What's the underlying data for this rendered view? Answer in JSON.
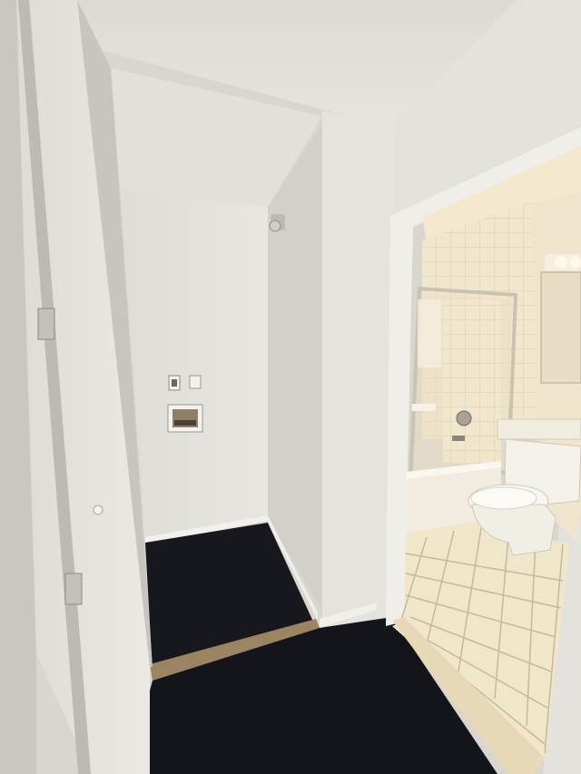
{
  "scene": {
    "subject": "hallway",
    "colors": {
      "ceiling": "#e4e2dc",
      "wall": "#e1dfd9",
      "wall_shadow": "#cfccc5",
      "carpet": "#15171d",
      "bathroom_tile": "#efe3c6",
      "door": "#e8e6e0",
      "toilet": "#f4f1ea"
    }
  }
}
